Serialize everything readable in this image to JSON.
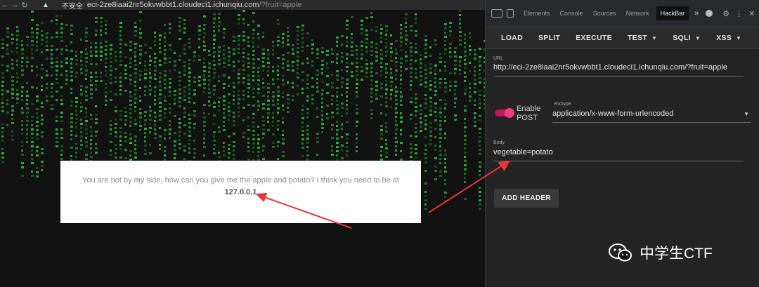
{
  "browser": {
    "security_label": "不安全",
    "url_host": "eci-2ze8iaai2nr5okvwbbt1.cloudeci1.ichunqiu.com",
    "url_query": "/?fruit=apple"
  },
  "page": {
    "message": "You are not by my side, how can you give me the apple and potato? I think you need to be at",
    "ip": "127.0.0.1"
  },
  "devtools": {
    "tabs": [
      "Elements",
      "Console",
      "Sources",
      "Network",
      "HackBar"
    ],
    "active_tab": "HackBar",
    "more_tabs": "»"
  },
  "hackbar": {
    "toolbar": {
      "load": "LOAD",
      "split": "SPLIT",
      "execute": "EXECUTE",
      "test": "TEST",
      "sqli": "SQLI",
      "xss": "XSS"
    },
    "url_label": "URL",
    "url_value": "http://eci-2ze8iaai2nr5okvwbbt1.cloudeci1.ichunqiu.com/?fruit=apple",
    "post_toggle_label": "Enable POST",
    "post_enabled": true,
    "enctype_label": "enctype",
    "enctype_value": "application/x-www-form-urlencoded",
    "body_label": "Body",
    "body_value": "vegetable=potato",
    "add_header": "ADD HEADER"
  },
  "watermark": {
    "text": "中学生CTF"
  },
  "colors": {
    "matrix_green": "#2ecc40",
    "toggle_pink": "#ec407a",
    "annotation_red": "#e53935"
  },
  "icons": [
    "back-arrow-icon",
    "forward-arrow-icon",
    "reload-icon",
    "warning-icon",
    "inspect-icon",
    "device-icon",
    "gear-icon",
    "more-vert-icon",
    "close-icon",
    "wechat-icon"
  ]
}
